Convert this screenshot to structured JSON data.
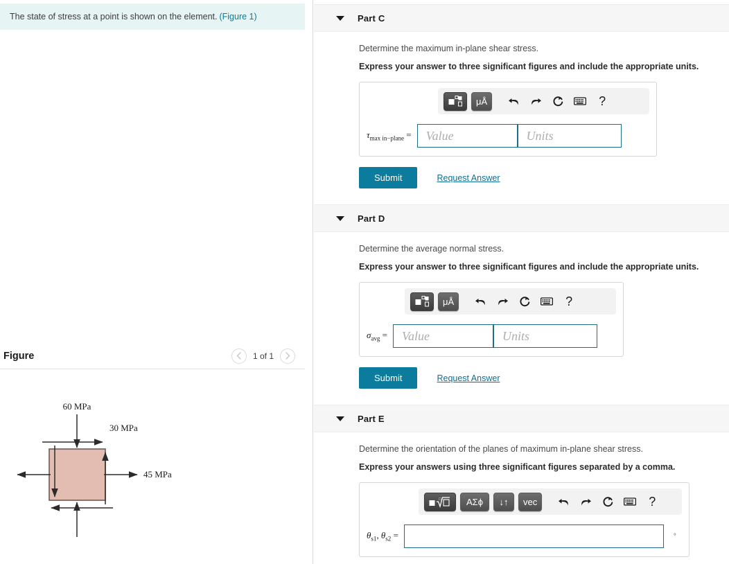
{
  "prompt": {
    "text": "The state of stress at a point is shown on the element.",
    "figure_link": "(Figure 1)"
  },
  "figure_panel": {
    "title": "Figure",
    "prev_icon": "chevron-left-icon",
    "next_icon": "chevron-right-icon",
    "counter": "1 of 1"
  },
  "figure_diagram": {
    "top_label": "60 MPa",
    "right_upper_label": "30 MPa",
    "right_label": "45 MPa",
    "element_fill": "#e3bdb1",
    "element_stroke": "#6a5b59"
  },
  "parts": [
    {
      "id": "part-c",
      "label": "Part C",
      "caret_icon": "caret-down-icon",
      "question": "Determine the maximum in-plane shear stress.",
      "instruction": "Express your answer to three significant figures and include the appropriate units.",
      "toolbar": {
        "keys": [
          "template-icon",
          "μÅ"
        ],
        "icons": [
          "undo-icon",
          "redo-icon",
          "reset-icon",
          "keyboard-icon",
          "help-icon"
        ]
      },
      "field_label_main": "τ",
      "field_label_sub": "max in−plane",
      "equals": "=",
      "value_placeholder": "Value",
      "units_placeholder": "Units",
      "submit_label": "Submit",
      "request_label": "Request Answer"
    },
    {
      "id": "part-d",
      "label": "Part D",
      "caret_icon": "caret-down-icon",
      "question": "Determine the average normal stress.",
      "instruction": "Express your answer to three significant figures and include the appropriate units.",
      "toolbar": {
        "keys": [
          "template-icon",
          "μÅ"
        ],
        "icons": [
          "undo-icon",
          "redo-icon",
          "reset-icon",
          "keyboard-icon",
          "help-icon"
        ]
      },
      "field_label_main": "σ",
      "field_label_sub": "avg",
      "equals": "=",
      "value_placeholder": "Value",
      "units_placeholder": "Units",
      "submit_label": "Submit",
      "request_label": "Request Answer"
    },
    {
      "id": "part-e",
      "label": "Part E",
      "caret_icon": "caret-down-icon",
      "question": "Determine the orientation of the planes of maximum in-plane shear stress.",
      "instruction": "Express your answers using three significant figures separated by a comma.",
      "toolbar": {
        "keys": [
          "radical-icon",
          "ΑΣϕ",
          "↓↑",
          "vec"
        ],
        "icons": [
          "undo-icon",
          "redo-icon",
          "reset-icon",
          "keyboard-icon",
          "help-icon"
        ]
      },
      "field_label": "θ",
      "field_sub_1": "s1",
      "field_sub_2": "s2",
      "equals": "=",
      "value": "",
      "degree_symbol": "°"
    }
  ],
  "colors": {
    "accent_teal": "#0b7c9e",
    "link_blue": "#0f6f93",
    "banner_bg": "#e6f4f4",
    "header_bg": "#f6f6f6",
    "input_border": "#1b6e84"
  }
}
